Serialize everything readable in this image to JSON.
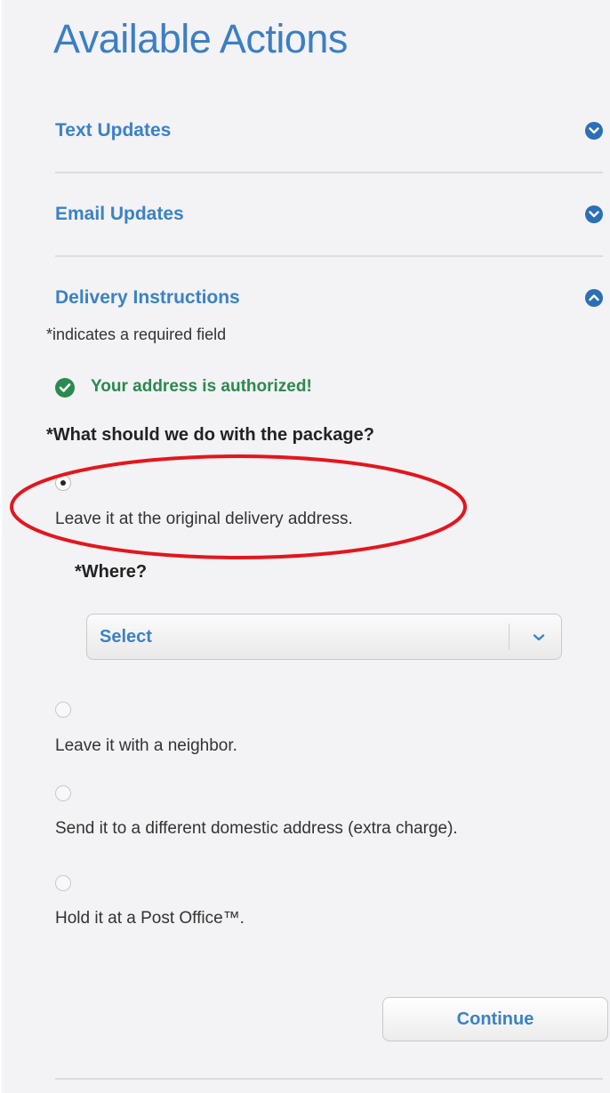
{
  "title": "Available Actions",
  "sections": [
    {
      "label": "Text Updates",
      "expanded": false
    },
    {
      "label": "Email Updates",
      "expanded": false
    },
    {
      "label": "Delivery Instructions",
      "expanded": true
    }
  ],
  "delivery": {
    "required_note": "*indicates a required field",
    "auth_message": "Your address is authorized!",
    "question": "*What should we do with the package?",
    "options": [
      {
        "label": "Leave it at the original delivery address.",
        "selected": true
      },
      {
        "label": "Leave it with a neighbor.",
        "selected": false
      },
      {
        "label": "Send it to a different domestic address (extra charge).",
        "selected": false
      },
      {
        "label": "Hold it at a Post Office™.",
        "selected": false
      }
    ],
    "where_label": "*Where?",
    "where_select": {
      "value": "Select"
    },
    "continue_label": "Continue"
  },
  "colors": {
    "link_blue": "#3b82c6",
    "success_green": "#2a8a4f",
    "annotation_red": "#e3161d",
    "background": "#f3f2f4"
  },
  "icons": {
    "collapsed": "chevron-down-icon",
    "expanded": "chevron-up-icon",
    "auth": "check-circle-icon",
    "select": "chevron-down-icon"
  }
}
